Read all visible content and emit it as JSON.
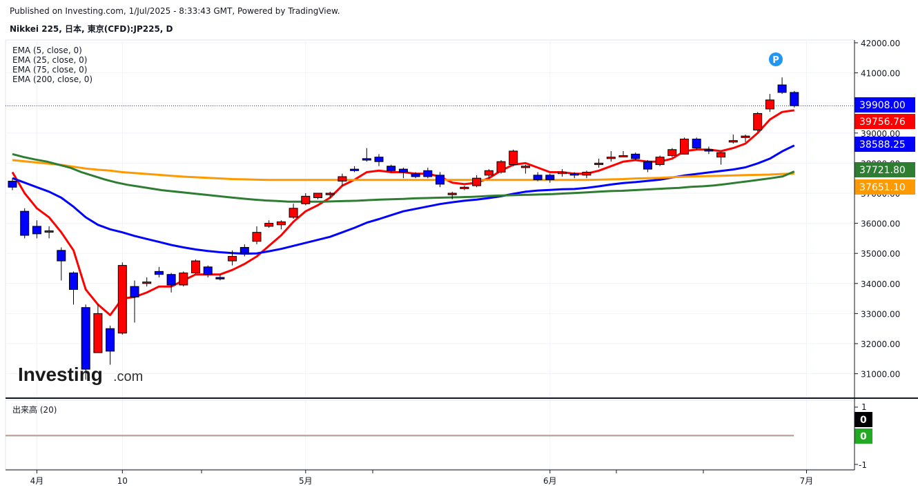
{
  "header": {
    "published": "Published on Investing.com, 1/Jul/2025 - 8:33:43 GMT, Powered by TradingView.",
    "symbol": "Nikkei 225, 日本, 東京(CFD):JP225, D"
  },
  "watermark": {
    "text_bold": "Investing",
    "text_light": ".com"
  },
  "colors": {
    "up": "#ff0000",
    "down": "#0000ff",
    "ema5": "#ff0000",
    "ema25": "#0000ff",
    "ema75": "#ff9900",
    "ema200": "#2e7d32",
    "last_line": "#1a1aa8"
  },
  "chart_data": {
    "type": "candlestick",
    "timeframe": "D",
    "y_axis_ticks": [
      31000,
      32000,
      33000,
      34000,
      35000,
      36000,
      37000,
      38000,
      39000,
      40000,
      41000,
      42000
    ],
    "y_tick_labels": [
      "31000.00",
      "32000.00",
      "33000.00",
      "34000.00",
      "35000.00",
      "36000.00",
      "37000.00",
      "38000.00",
      "39000.00",
      "40000.00",
      "41000.00",
      "42000.00"
    ],
    "ylim": [
      30200,
      42300
    ],
    "x_tick_labels": [
      {
        "label": "4月",
        "index": 2
      },
      {
        "label": "10",
        "index": 9
      },
      {
        "label": "5月",
        "index": 24
      },
      {
        "label": "6月",
        "index": 44
      },
      {
        "label": "7月",
        "index": 65
      }
    ],
    "candles": [
      {
        "d": "2025-03-31",
        "o": 37400,
        "h": 37500,
        "l": 37100,
        "c": 37200
      },
      {
        "d": "2025-04-01",
        "o": 36400,
        "h": 36500,
        "l": 35500,
        "c": 35600
      },
      {
        "d": "2025-04-02",
        "o": 35900,
        "h": 36100,
        "l": 35500,
        "c": 35650
      },
      {
        "d": "2025-04-03",
        "o": 35750,
        "h": 35900,
        "l": 35500,
        "c": 35750
      },
      {
        "d": "2025-04-04",
        "o": 35100,
        "h": 35200,
        "l": 34100,
        "c": 34750
      },
      {
        "d": "2025-04-07",
        "o": 34350,
        "h": 34400,
        "l": 33300,
        "c": 33800
      },
      {
        "d": "2025-04-08",
        "o": 33200,
        "h": 33300,
        "l": 30800,
        "c": 31150
      },
      {
        "d": "2025-04-09",
        "o": 31700,
        "h": 33300,
        "l": 31700,
        "c": 33000
      },
      {
        "d": "2025-04-10",
        "o": 32500,
        "h": 32600,
        "l": 31300,
        "c": 31750
      },
      {
        "d": "2025-04-11",
        "o": 32350,
        "h": 34700,
        "l": 32300,
        "c": 34600
      },
      {
        "d": "2025-04-14",
        "o": 33900,
        "h": 34100,
        "l": 32700,
        "c": 33550
      },
      {
        "d": "2025-04-15",
        "o": 34000,
        "h": 34200,
        "l": 33900,
        "c": 34050
      },
      {
        "d": "2025-04-16",
        "o": 34400,
        "h": 34550,
        "l": 34200,
        "c": 34300
      },
      {
        "d": "2025-04-17",
        "o": 34300,
        "h": 34350,
        "l": 33700,
        "c": 33950
      },
      {
        "d": "2025-04-18",
        "o": 33950,
        "h": 34400,
        "l": 33900,
        "c": 34350
      },
      {
        "d": "2025-04-21",
        "o": 34350,
        "h": 34800,
        "l": 34300,
        "c": 34750
      },
      {
        "d": "2025-04-22",
        "o": 34550,
        "h": 34600,
        "l": 34200,
        "c": 34300
      },
      {
        "d": "2025-04-23",
        "o": 34200,
        "h": 34300,
        "l": 34100,
        "c": 34150
      },
      {
        "d": "2025-04-24",
        "o": 34750,
        "h": 35100,
        "l": 34600,
        "c": 34900
      },
      {
        "d": "2025-04-25",
        "o": 35200,
        "h": 35300,
        "l": 34900,
        "c": 35000
      },
      {
        "d": "2025-04-28",
        "o": 35400,
        "h": 35900,
        "l": 35300,
        "c": 35700
      },
      {
        "d": "2025-04-30",
        "o": 35900,
        "h": 36100,
        "l": 35850,
        "c": 36000
      },
      {
        "d": "2025-05-01",
        "o": 35950,
        "h": 36100,
        "l": 35800,
        "c": 36050
      },
      {
        "d": "2025-05-02",
        "o": 36200,
        "h": 36650,
        "l": 36150,
        "c": 36500
      },
      {
        "d": "2025-05-07",
        "o": 36650,
        "h": 37000,
        "l": 36600,
        "c": 36900
      },
      {
        "d": "2025-05-08",
        "o": 36850,
        "h": 37000,
        "l": 36800,
        "c": 37000
      },
      {
        "d": "2025-05-09",
        "o": 36950,
        "h": 37050,
        "l": 36850,
        "c": 37000
      },
      {
        "d": "2025-05-12",
        "o": 37400,
        "h": 37650,
        "l": 37250,
        "c": 37550
      },
      {
        "d": "2025-05-13",
        "o": 37800,
        "h": 37900,
        "l": 37700,
        "c": 37750
      },
      {
        "d": "2025-05-14",
        "o": 38150,
        "h": 38500,
        "l": 38050,
        "c": 38100
      },
      {
        "d": "2025-05-15",
        "o": 38200,
        "h": 38300,
        "l": 37900,
        "c": 38050
      },
      {
        "d": "2025-05-16",
        "o": 37900,
        "h": 37950,
        "l": 37700,
        "c": 37750
      },
      {
        "d": "2025-05-19",
        "o": 37800,
        "h": 37850,
        "l": 37500,
        "c": 37700
      },
      {
        "d": "2025-05-20",
        "o": 37650,
        "h": 37700,
        "l": 37500,
        "c": 37550
      },
      {
        "d": "2025-05-21",
        "o": 37750,
        "h": 37850,
        "l": 37500,
        "c": 37550
      },
      {
        "d": "2025-05-22",
        "o": 37600,
        "h": 37700,
        "l": 37200,
        "c": 37300
      },
      {
        "d": "2025-05-23",
        "o": 36950,
        "h": 37050,
        "l": 36800,
        "c": 37000
      },
      {
        "d": "2025-05-26",
        "o": 37150,
        "h": 37250,
        "l": 37100,
        "c": 37200
      },
      {
        "d": "2025-05-27",
        "o": 37250,
        "h": 37600,
        "l": 37200,
        "c": 37500
      },
      {
        "d": "2025-05-28",
        "o": 37600,
        "h": 37800,
        "l": 37500,
        "c": 37750
      },
      {
        "d": "2025-05-29",
        "o": 37700,
        "h": 38100,
        "l": 37650,
        "c": 38050
      },
      {
        "d": "2025-05-30",
        "o": 37950,
        "h": 38450,
        "l": 37900,
        "c": 38400
      },
      {
        "d": "2025-06-02",
        "o": 37850,
        "h": 37950,
        "l": 37650,
        "c": 37900
      },
      {
        "d": "2025-06-03",
        "o": 37600,
        "h": 37700,
        "l": 37400,
        "c": 37450
      },
      {
        "d": "2025-06-04",
        "o": 37600,
        "h": 37650,
        "l": 37350,
        "c": 37450
      },
      {
        "d": "2025-06-05",
        "o": 37650,
        "h": 37800,
        "l": 37550,
        "c": 37700
      },
      {
        "d": "2025-06-06",
        "o": 37650,
        "h": 37700,
        "l": 37500,
        "c": 37600
      },
      {
        "d": "2025-06-09",
        "o": 37600,
        "h": 37750,
        "l": 37500,
        "c": 37700
      },
      {
        "d": "2025-06-10",
        "o": 37950,
        "h": 38150,
        "l": 37850,
        "c": 38000
      },
      {
        "d": "2025-06-11",
        "o": 38150,
        "h": 38400,
        "l": 38050,
        "c": 38200
      },
      {
        "d": "2025-06-12",
        "o": 38250,
        "h": 38400,
        "l": 38200,
        "c": 38250
      },
      {
        "d": "2025-06-13",
        "o": 38300,
        "h": 38350,
        "l": 38100,
        "c": 38150
      },
      {
        "d": "2025-06-16",
        "o": 38050,
        "h": 38100,
        "l": 37700,
        "c": 37800
      },
      {
        "d": "2025-06-17",
        "o": 37950,
        "h": 38250,
        "l": 37900,
        "c": 38200
      },
      {
        "d": "2025-06-18",
        "o": 38250,
        "h": 38500,
        "l": 38200,
        "c": 38450
      },
      {
        "d": "2025-06-19",
        "o": 38300,
        "h": 38850,
        "l": 38300,
        "c": 38800
      },
      {
        "d": "2025-06-20",
        "o": 38800,
        "h": 38850,
        "l": 38450,
        "c": 38500
      },
      {
        "d": "2025-06-23",
        "o": 38450,
        "h": 38550,
        "l": 38300,
        "c": 38400
      },
      {
        "d": "2025-06-24",
        "o": 38200,
        "h": 38300,
        "l": 37950,
        "c": 38350
      },
      {
        "d": "2025-06-25",
        "o": 38700,
        "h": 38950,
        "l": 38650,
        "c": 38750
      },
      {
        "d": "2025-06-26",
        "o": 38850,
        "h": 38950,
        "l": 38700,
        "c": 38900
      },
      {
        "d": "2025-06-27",
        "o": 39100,
        "h": 39700,
        "l": 39050,
        "c": 39650
      },
      {
        "d": "2025-06-30",
        "o": 39800,
        "h": 40300,
        "l": 39700,
        "c": 40100
      },
      {
        "d": "2025-07-01",
        "o": 40600,
        "h": 40850,
        "l": 40300,
        "c": 40350
      },
      {
        "d": "2025-07-02",
        "o": 40350,
        "h": 40400,
        "l": 39850,
        "c": 39908
      }
    ],
    "series": [
      {
        "name": "EMA (5, close, 0)",
        "key": "ema5",
        "values": [
          37700,
          37000,
          36500,
          36200,
          35700,
          35100,
          33800,
          33300,
          32950,
          33500,
          33550,
          33700,
          33900,
          33900,
          34100,
          34300,
          34300,
          34300,
          34450,
          34650,
          34900,
          35250,
          35600,
          36050,
          36400,
          36600,
          36850,
          37250,
          37450,
          37700,
          37750,
          37700,
          37700,
          37650,
          37650,
          37550,
          37350,
          37300,
          37350,
          37500,
          37750,
          37950,
          38000,
          37850,
          37700,
          37700,
          37650,
          37650,
          37750,
          37900,
          38050,
          38100,
          38050,
          38050,
          38150,
          38400,
          38450,
          38450,
          38400,
          38500,
          38650,
          39000,
          39450,
          39700,
          39756.76
        ]
      },
      {
        "name": "EMA (25, close, 0)",
        "key": "ema25",
        "values": [
          37500,
          37350,
          37200,
          37050,
          36850,
          36550,
          36200,
          35950,
          35800,
          35700,
          35580,
          35480,
          35380,
          35280,
          35200,
          35130,
          35080,
          35040,
          35010,
          34990,
          35000,
          35070,
          35150,
          35250,
          35350,
          35450,
          35550,
          35700,
          35850,
          36020,
          36140,
          36270,
          36400,
          36480,
          36560,
          36640,
          36700,
          36750,
          36790,
          36840,
          36900,
          36980,
          37050,
          37090,
          37110,
          37130,
          37140,
          37180,
          37230,
          37290,
          37340,
          37370,
          37410,
          37450,
          37520,
          37590,
          37640,
          37690,
          37740,
          37790,
          37860,
          37990,
          38150,
          38390,
          38588.25
        ]
      },
      {
        "name": "EMA (75, close, 0)",
        "key": "ema75",
        "values": [
          38100,
          38060,
          38020,
          37980,
          37940,
          37880,
          37820,
          37780,
          37750,
          37700,
          37670,
          37640,
          37610,
          37580,
          37550,
          37530,
          37510,
          37490,
          37470,
          37460,
          37450,
          37440,
          37440,
          37440,
          37440,
          37440,
          37440,
          37440,
          37440,
          37440,
          37440,
          37440,
          37440,
          37440,
          37440,
          37440,
          37440,
          37440,
          37440,
          37440,
          37440,
          37440,
          37440,
          37440,
          37440,
          37440,
          37440,
          37440,
          37450,
          37460,
          37470,
          37490,
          37500,
          37510,
          37530,
          37550,
          37560,
          37570,
          37580,
          37590,
          37600,
          37610,
          37620,
          37640,
          37651.1
        ]
      },
      {
        "name": "EMA (200, close, 0)",
        "key": "ema200",
        "values": [
          38300,
          38200,
          38120,
          38050,
          37950,
          37850,
          37700,
          37580,
          37460,
          37360,
          37280,
          37220,
          37160,
          37100,
          37060,
          37020,
          36980,
          36940,
          36900,
          36860,
          36820,
          36790,
          36760,
          36740,
          36720,
          36720,
          36720,
          36720,
          36730,
          36740,
          36750,
          36770,
          36790,
          36800,
          36810,
          36830,
          36840,
          36850,
          36860,
          36870,
          36880,
          36900,
          36920,
          36930,
          36940,
          36950,
          36960,
          36970,
          36990,
          37010,
          37030,
          37050,
          37070,
          37080,
          37100,
          37120,
          37140,
          37160,
          37180,
          37210,
          37230,
          37260,
          37300,
          37350,
          37400,
          37450,
          37500,
          37560,
          37721.8
        ]
      }
    ],
    "price_tags": [
      {
        "label": "39908.00",
        "value": 39908,
        "color": "#0000ff"
      },
      {
        "label": "39756.76",
        "value": 39756.76,
        "color": "#ff0000"
      },
      {
        "label": "38588.25",
        "value": 38588.25,
        "color": "#0000ff"
      },
      {
        "label": "37721.80",
        "value": 37721.8,
        "color": "#2e7d32"
      },
      {
        "label": "37651.10",
        "value": 37651.1,
        "color": "#ff9900"
      }
    ],
    "volume_pane": {
      "title": "出来高 (20)",
      "ticks": [
        "1",
        "-1"
      ],
      "tags": [
        {
          "label": "0",
          "color": "#000000"
        },
        {
          "label": "0",
          "color": "#22aa22"
        }
      ]
    },
    "marker": {
      "label": "P",
      "color": "#2196f3"
    }
  }
}
